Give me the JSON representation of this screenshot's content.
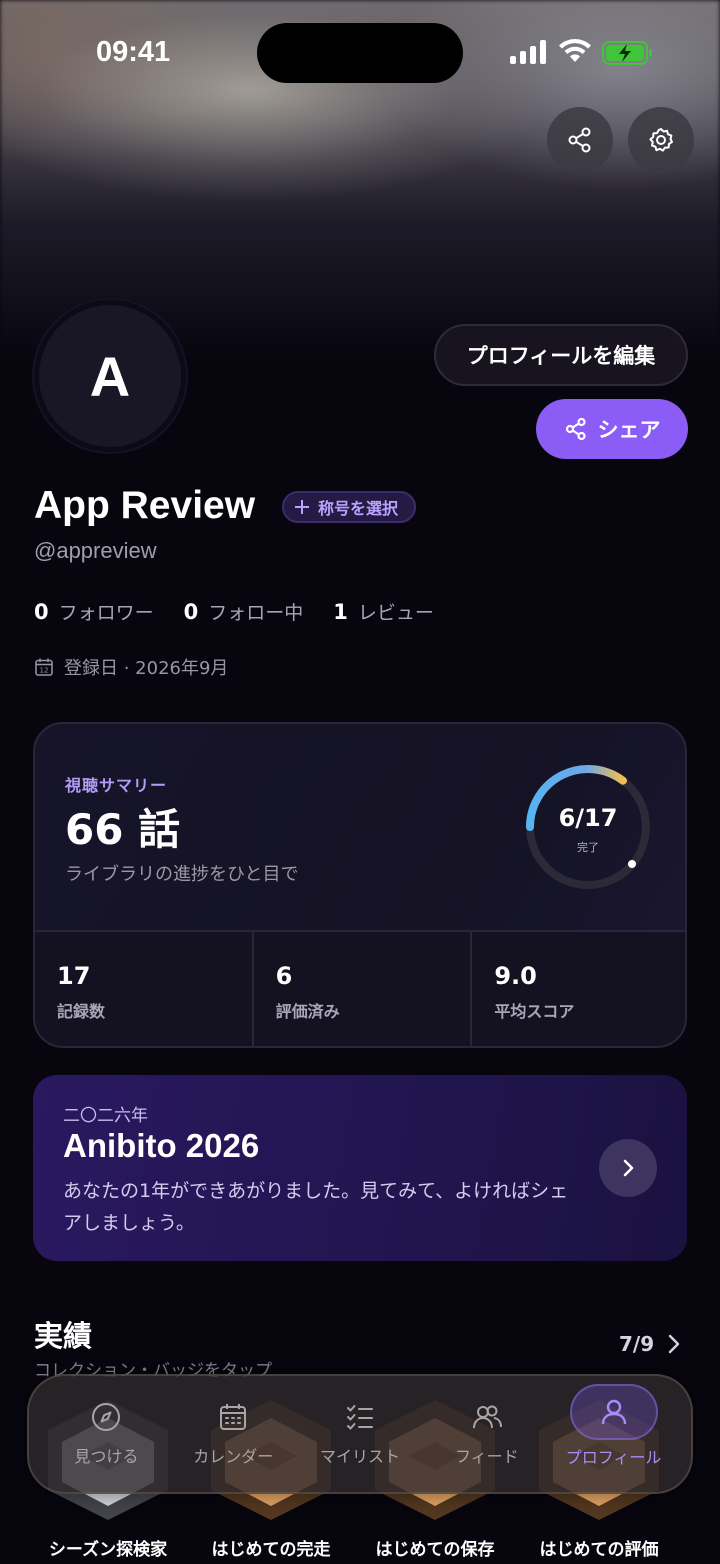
{
  "status_bar": {
    "time": "09:41"
  },
  "profile": {
    "avatar_letter": "A",
    "edit_label": "プロフィールを編集",
    "share_label": "シェア",
    "name": "App Review",
    "title_chip": "称号を選択",
    "handle": "@appreview",
    "stats": [
      {
        "value": "0",
        "label": "フォロワー"
      },
      {
        "value": "0",
        "label": "フォロー中"
      },
      {
        "value": "1",
        "label": "レビュー"
      }
    ],
    "joined": "登録日 · 2026年9月",
    "calendar_day": "12"
  },
  "summary": {
    "label": "視聴サマリー",
    "count": "66 話",
    "subtitle": "ライブラリの進捗をひと目で",
    "ring_value": "6/17",
    "ring_caption": "完了",
    "completed": 6,
    "total": 17,
    "metrics": [
      {
        "value": "17",
        "label": "記録数"
      },
      {
        "value": "6",
        "label": "評価済み"
      },
      {
        "value": "9.0",
        "label": "平均スコア"
      }
    ]
  },
  "promo": {
    "kicker": "二〇二六年",
    "title": "Anibito 2026",
    "body": "あなたの1年ができあがりました。見てみて、よければシェアしましょう。"
  },
  "achievements": {
    "title": "実績",
    "subtitle": "コレクション・バッジをタップ",
    "count": "7/9",
    "badges": [
      {
        "label": "シーズン探検家",
        "tier": "silver"
      },
      {
        "label": "はじめての完走",
        "tier": "bronze"
      },
      {
        "label": "はじめての保存",
        "tier": "bronze"
      },
      {
        "label": "はじめての評価",
        "tier": "bronze"
      }
    ]
  },
  "tabbar": {
    "tabs": [
      {
        "label": "見つける",
        "icon": "compass-icon"
      },
      {
        "label": "カレンダー",
        "icon": "calendar-icon"
      },
      {
        "label": "マイリスト",
        "icon": "checklist-icon"
      },
      {
        "label": "フィード",
        "icon": "people-icon"
      },
      {
        "label": "プロフィール",
        "icon": "person-icon",
        "active": true
      }
    ]
  },
  "colors": {
    "accent": "#8b5cf6",
    "background": "#07060f"
  }
}
